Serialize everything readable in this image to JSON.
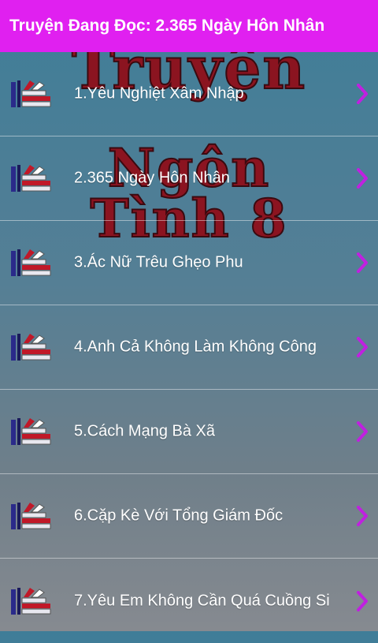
{
  "title": "Truyện Đang Đọc: 2.365 Ngày Hôn Nhân",
  "background_art": {
    "line1": "Truyện",
    "line2": "Ngôn",
    "line3": "Tình 8"
  },
  "colors": {
    "titlebar": "#e020f0",
    "chevron": "#c020e0",
    "text": "#ffffff"
  },
  "items": [
    {
      "label": "1.Yêu Nghiệt Xâm Nhập",
      "icon": "book-stack-icon"
    },
    {
      "label": "2.365 Ngày Hôn Nhân",
      "icon": "book-stack-icon"
    },
    {
      "label": "3.Ác Nữ Trêu Ghẹo Phu",
      "icon": "book-stack-icon"
    },
    {
      "label": "4.Anh Cả Không Làm Không Công",
      "icon": "book-stack-icon"
    },
    {
      "label": "5.Cách Mạng Bà Xã",
      "icon": "book-stack-icon"
    },
    {
      "label": "6.Cặp Kè Với Tổng Giám Đốc",
      "icon": "book-stack-icon"
    },
    {
      "label": "7.Yêu Em Không Cần Quá Cuồng Si",
      "icon": "book-stack-icon"
    }
  ]
}
